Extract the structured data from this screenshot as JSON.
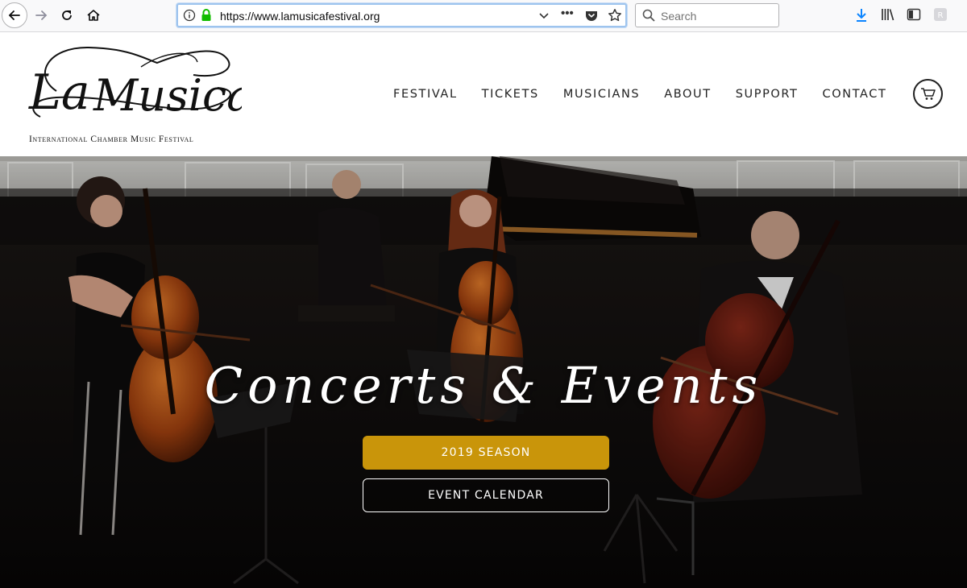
{
  "browser": {
    "url": "https://www.lamusicafestival.org",
    "search_placeholder": "Search",
    "icons": [
      "back-icon",
      "forward-icon",
      "reload-icon",
      "home-icon",
      "info-icon",
      "lock-icon",
      "chevron-down-icon",
      "more-icon",
      "pocket-icon",
      "bookmark-star-icon",
      "search-icon",
      "download-icon",
      "library-icon",
      "sidebar-icon",
      "extension-icon"
    ],
    "colors": {
      "lock": "#12bc00",
      "download": "#0a84ff"
    }
  },
  "site": {
    "logo_text": "La Musica",
    "tagline": "International Chamber Music Festival",
    "nav": [
      "FESTIVAL",
      "TICKETS",
      "MUSICIANS",
      "ABOUT",
      "SUPPORT",
      "CONTACT"
    ],
    "cart_icon": "cart-icon"
  },
  "hero": {
    "title": "Concerts & Events",
    "primary_button": "2019 SEASON",
    "secondary_button": "EVENT CALENDAR",
    "colors": {
      "primary_button": "#c9950a"
    }
  }
}
